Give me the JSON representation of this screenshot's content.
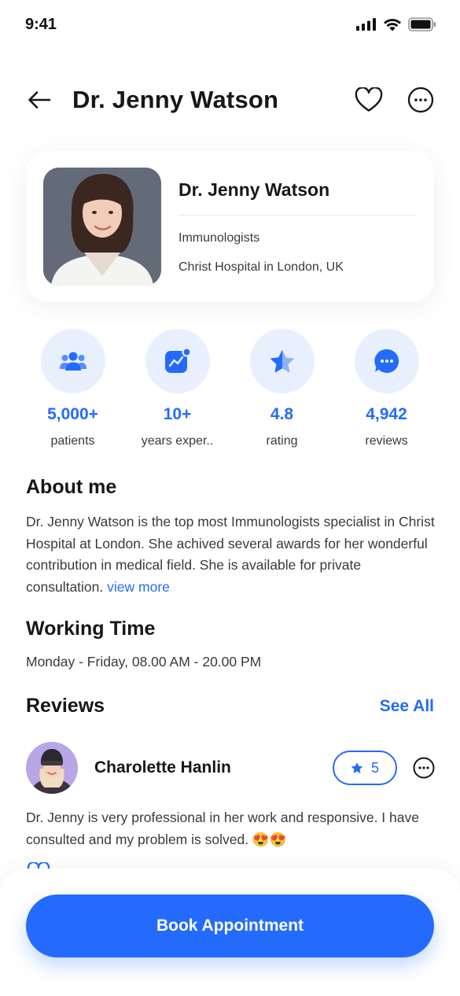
{
  "status": {
    "time": "9:41"
  },
  "header": {
    "title": "Dr. Jenny Watson"
  },
  "profile": {
    "name": "Dr. Jenny Watson",
    "specialty": "Immunologists",
    "hospital": "Christ Hospital in London, UK"
  },
  "stats": [
    {
      "icon": "people-icon",
      "value": "5,000+",
      "label": "patients"
    },
    {
      "icon": "chart-icon",
      "value": "10+",
      "label": "years exper.."
    },
    {
      "icon": "star-icon",
      "value": "4.8",
      "label": "rating"
    },
    {
      "icon": "chat-icon",
      "value": "4,942",
      "label": "reviews"
    }
  ],
  "about": {
    "title": "About me",
    "text": "Dr. Jenny Watson is the top most Immunologists specialist in Christ Hospital at London. She achived several awards for her wonderful contribution in medical field. She is available for private consultation.",
    "link": "view more"
  },
  "working": {
    "title": "Working Time",
    "text": "Monday - Friday, 08.00 AM - 20.00 PM"
  },
  "reviews": {
    "title": "Reviews",
    "see_all": "See All",
    "items": [
      {
        "name": "Charolette Hanlin",
        "rating": "5",
        "text": "Dr. Jenny is very professional in her work and responsive. I have consulted and my problem is solved. 😍😍"
      }
    ]
  },
  "book_button": "Book Appointment",
  "colors": {
    "accent": "#246bfd",
    "accent_light": "#e9f0fd",
    "text": "#17171a"
  }
}
